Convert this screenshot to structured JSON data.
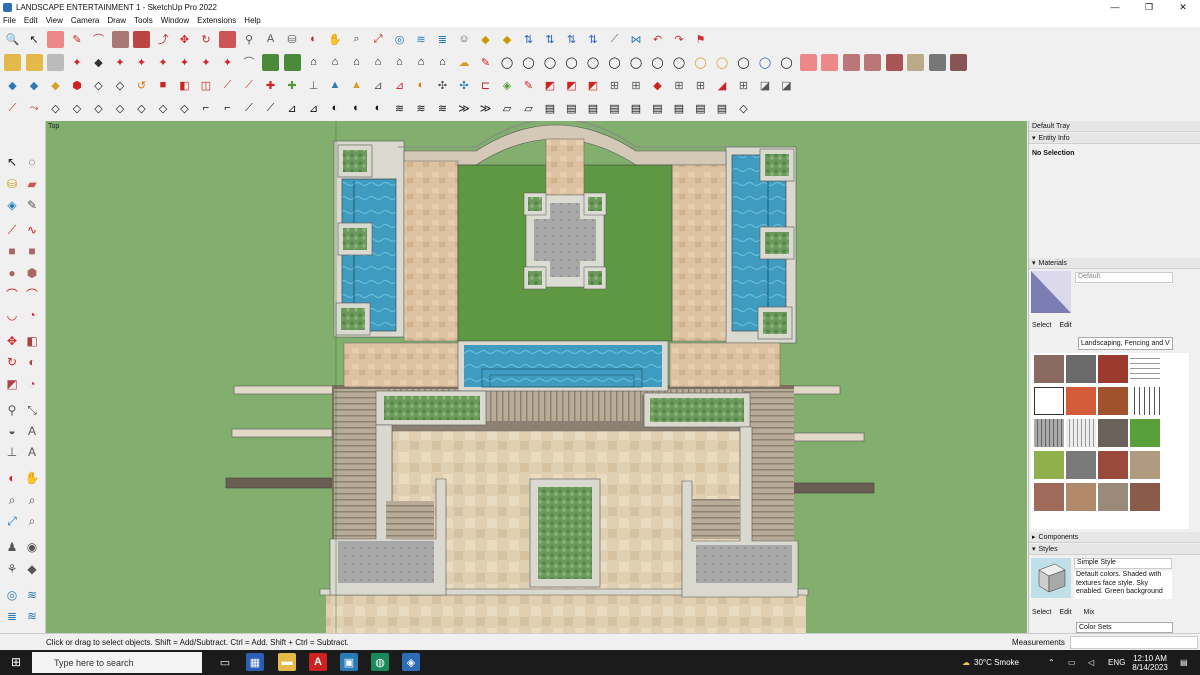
{
  "window": {
    "title": "LANDSCAPE ENTERTAINMENT 1 - SketchUp Pro 2022",
    "minimize": "—",
    "maximize": "❐",
    "close": "✕"
  },
  "menu": [
    "File",
    "Edit",
    "View",
    "Camera",
    "Draw",
    "Tools",
    "Window",
    "Extensions",
    "Help"
  ],
  "viewport": {
    "scene_label": "Top"
  },
  "tray": {
    "title": "Default Tray",
    "entity_info": {
      "header": "Entity Info",
      "status": "No Selection"
    },
    "materials": {
      "header": "Materials",
      "name_placeholder": "Default",
      "tabs": [
        "Select",
        "Edit"
      ],
      "library": "Landscaping, Fencing and V"
    },
    "components": {
      "header": "Components"
    },
    "styles": {
      "header": "Styles",
      "name": "Simple Style",
      "description": "Default colors. Shaded with textures face style. Sky enabled. Green background",
      "tabs": [
        "Select",
        "Edit",
        "Mix"
      ],
      "library": "Color Sets"
    }
  },
  "status": {
    "message": "Click or drag to select objects. Shift = Add/Subtract. Ctrl = Add. Shift + Ctrl = Subtract.",
    "measurements_label": "Measurements"
  },
  "taskbar": {
    "search_placeholder": "Type here to search",
    "weather": "30°C  Smoke",
    "language": "ENG",
    "time": "12:10 AM",
    "date": "8/14/2023"
  },
  "colors": {
    "viewport_background": "#82ae6e",
    "lawn": "#5f9842",
    "water": "#3f9cc0",
    "paving": "#d9c3a0",
    "planter": "#6f9a60"
  }
}
